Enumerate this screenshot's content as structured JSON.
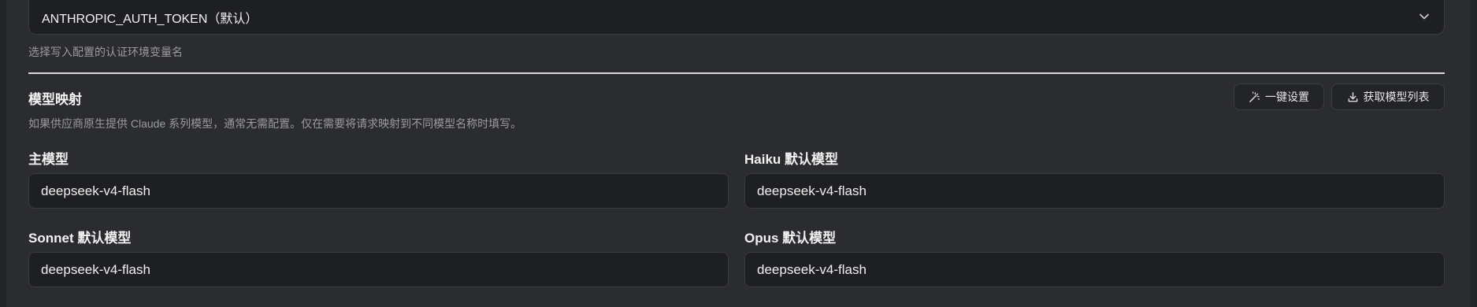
{
  "auth_env": {
    "selected": "ANTHROPIC_AUTH_TOKEN（默认）",
    "hint": "选择写入配置的认证环境变量名"
  },
  "model_mapping": {
    "title": "模型映射",
    "description": "如果供应商原生提供 Claude 系列模型，通常无需配置。仅在需要将请求映射到不同模型名称时填写。",
    "one_click_label": "一键设置",
    "fetch_list_label": "获取模型列表",
    "fields": {
      "main": {
        "label": "主模型",
        "value": "deepseek-v4-flash"
      },
      "haiku": {
        "label": "Haiku 默认模型",
        "value": "deepseek-v4-flash"
      },
      "sonnet": {
        "label": "Sonnet 默认模型",
        "value": "deepseek-v4-flash"
      },
      "opus": {
        "label": "Opus 默认模型",
        "value": "deepseek-v4-flash"
      }
    }
  }
}
